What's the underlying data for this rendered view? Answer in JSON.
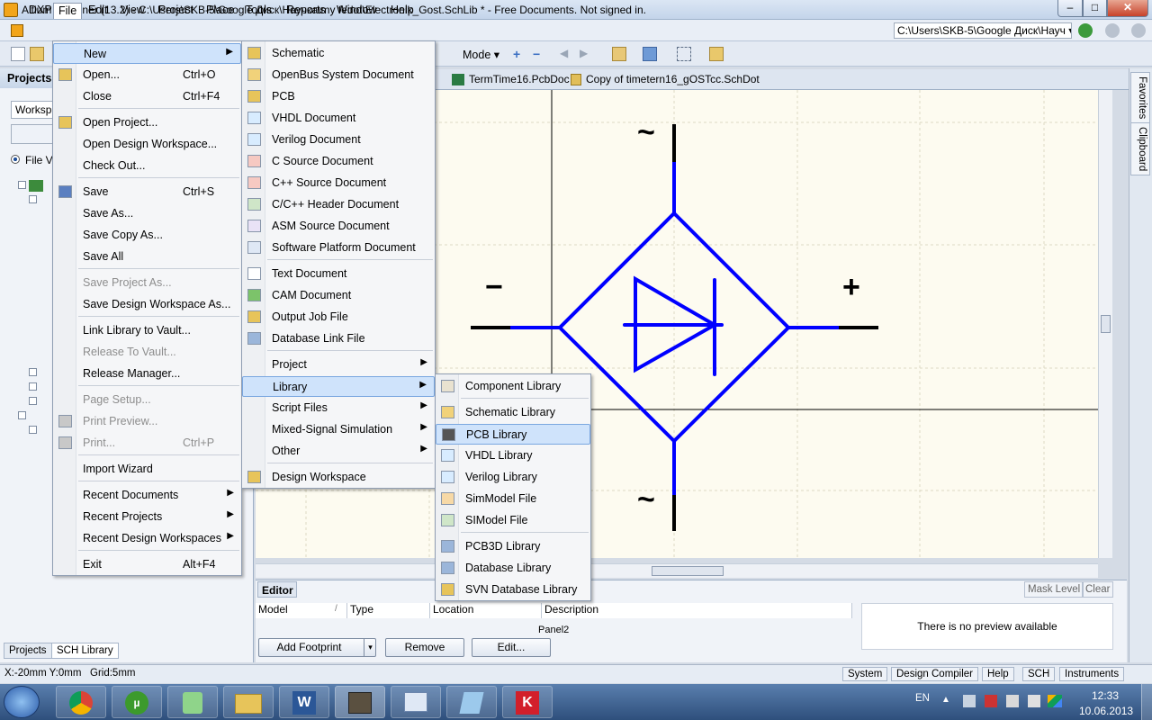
{
  "window": {
    "title": "Altium Designer (13.2) - C:\\Users\\SKB-5\\Google Диск\\Научка\\my fedot\\Electronik_Gost.SchLib * - Free Documents. Not signed in.",
    "min": "–",
    "max": "□",
    "close": "✕"
  },
  "menubar": {
    "items": [
      "DXP",
      "File",
      "Edit",
      "View",
      "Project",
      "Place",
      "Tools",
      "Reports",
      "Window",
      "Help"
    ],
    "path": "C:\\Users\\SKB-5\\Google Диск\\Науч ▾"
  },
  "toolbar": {
    "mode_label": "Mode ▾"
  },
  "projects_panel": {
    "title": "Projects",
    "workspace_label": "Worksp",
    "file_view_label": "File V",
    "tabs": [
      "Projects",
      "SCH Library"
    ]
  },
  "doc_tabs": [
    "TermTime16.PcbDoc",
    "Copy of timetern16_gOSTcc.SchDot"
  ],
  "right_dock": [
    "Favorites",
    "Clipboard"
  ],
  "schematic": {
    "labels": [
      "~",
      "−",
      "+",
      "~"
    ],
    "colors": {
      "wire": "#0000ff",
      "pin": "#000000",
      "grid": "#e4e1cf"
    }
  },
  "editor": {
    "title": "Editor",
    "mask_level": "Mask Level",
    "clear": "Clear",
    "columns": [
      "Model",
      "Type",
      "Location",
      "Description"
    ],
    "panel_label": "Panel2",
    "preview_text": "There is no preview available",
    "buttons": {
      "add_footprint": "Add Footprint",
      "remove": "Remove",
      "edit": "Edit..."
    }
  },
  "statusbar": {
    "coords": "X:-20mm Y:0mm   Grid:5mm",
    "tabs": [
      "System",
      "Design Compiler",
      "Help",
      "SCH",
      "Instruments"
    ]
  },
  "taskbar": {
    "lang": "EN",
    "time": "12:33",
    "date": "10.06.2013"
  },
  "file_menu": {
    "items": [
      {
        "label": "New",
        "shortcut": "",
        "submenu": true,
        "disabled": false,
        "highlight": true
      },
      {
        "label": "Open...",
        "shortcut": "Ctrl+O"
      },
      {
        "label": "Close",
        "shortcut": "Ctrl+F4"
      },
      {
        "label": "Open Project..."
      },
      {
        "label": "Open Design Workspace..."
      },
      {
        "label": "Check Out..."
      },
      {
        "label": "Save",
        "shortcut": "Ctrl+S"
      },
      {
        "label": "Save As..."
      },
      {
        "label": "Save Copy As..."
      },
      {
        "label": "Save All"
      },
      {
        "label": "Save Project As...",
        "disabled": true
      },
      {
        "label": "Save Design Workspace As..."
      },
      {
        "label": "Link Library to Vault..."
      },
      {
        "label": "Release To Vault...",
        "disabled": true
      },
      {
        "label": "Release Manager..."
      },
      {
        "label": "Page Setup...",
        "disabled": true
      },
      {
        "label": "Print Preview...",
        "disabled": true
      },
      {
        "label": "Print...",
        "shortcut": "Ctrl+P",
        "disabled": true
      },
      {
        "label": "Import Wizard"
      },
      {
        "label": "Recent Documents",
        "submenu": true
      },
      {
        "label": "Recent Projects",
        "submenu": true
      },
      {
        "label": "Recent Design Workspaces",
        "submenu": true
      },
      {
        "label": "Exit",
        "shortcut": "Alt+F4"
      }
    ]
  },
  "new_menu": {
    "items": [
      {
        "label": "Schematic"
      },
      {
        "label": "OpenBus System Document"
      },
      {
        "label": "PCB"
      },
      {
        "label": "VHDL Document"
      },
      {
        "label": "Verilog Document"
      },
      {
        "label": "C Source Document"
      },
      {
        "label": "C++ Source Document"
      },
      {
        "label": "C/C++ Header Document"
      },
      {
        "label": "ASM Source Document"
      },
      {
        "label": "Software Platform Document"
      },
      {
        "label": "Text Document"
      },
      {
        "label": "CAM Document"
      },
      {
        "label": "Output Job File"
      },
      {
        "label": "Database Link File"
      },
      {
        "label": "Project",
        "submenu": true
      },
      {
        "label": "Library",
        "submenu": true,
        "highlight": true
      },
      {
        "label": "Script Files",
        "submenu": true
      },
      {
        "label": "Mixed-Signal Simulation",
        "submenu": true
      },
      {
        "label": "Other",
        "submenu": true
      },
      {
        "label": "Design Workspace"
      }
    ]
  },
  "library_menu": {
    "items": [
      {
        "label": "Component Library"
      },
      {
        "label": "Schematic Library"
      },
      {
        "label": "PCB Library",
        "highlight": true
      },
      {
        "label": "VHDL Library"
      },
      {
        "label": "Verilog Library"
      },
      {
        "label": "SimModel File"
      },
      {
        "label": "SIModel File"
      },
      {
        "label": "PCB3D Library"
      },
      {
        "label": "Database Library"
      },
      {
        "label": "SVN Database Library"
      }
    ]
  }
}
